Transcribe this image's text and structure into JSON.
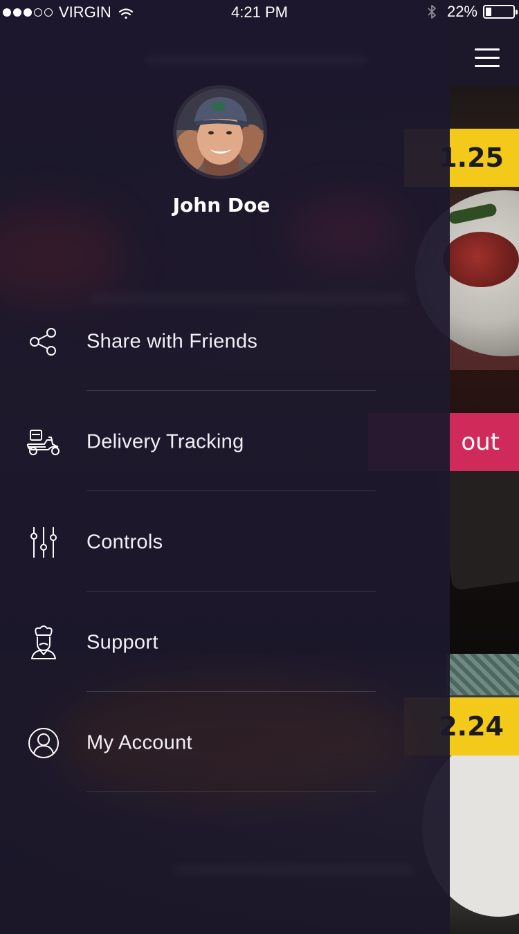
{
  "status_bar": {
    "carrier": "VIRGIN",
    "signal_bars_filled": 3,
    "signal_bars_total": 5,
    "time": "4:21 PM",
    "battery_percent": "22%",
    "battery_level": 0.22,
    "icons": [
      "wifi-icon",
      "bluetooth-icon",
      "battery-icon"
    ]
  },
  "background": {
    "price_1": "1.25",
    "price_2": "2.24",
    "checkout_label": "out",
    "menu_icon": "hamburger-menu-icon"
  },
  "profile": {
    "name": "John Doe"
  },
  "menu": {
    "items": [
      {
        "label": "Share with Friends",
        "icon": "share-icon"
      },
      {
        "label": "Delivery Tracking",
        "icon": "delivery-scooter-icon"
      },
      {
        "label": "Controls",
        "icon": "sliders-icon"
      },
      {
        "label": "Support",
        "icon": "chef-icon"
      },
      {
        "label": "My Account",
        "icon": "user-circle-icon"
      }
    ]
  },
  "colors": {
    "drawer_bg": "#1c172c",
    "price_tag": "#f3c91a",
    "checkout": "#d02a5a",
    "text": "#ffffff"
  }
}
